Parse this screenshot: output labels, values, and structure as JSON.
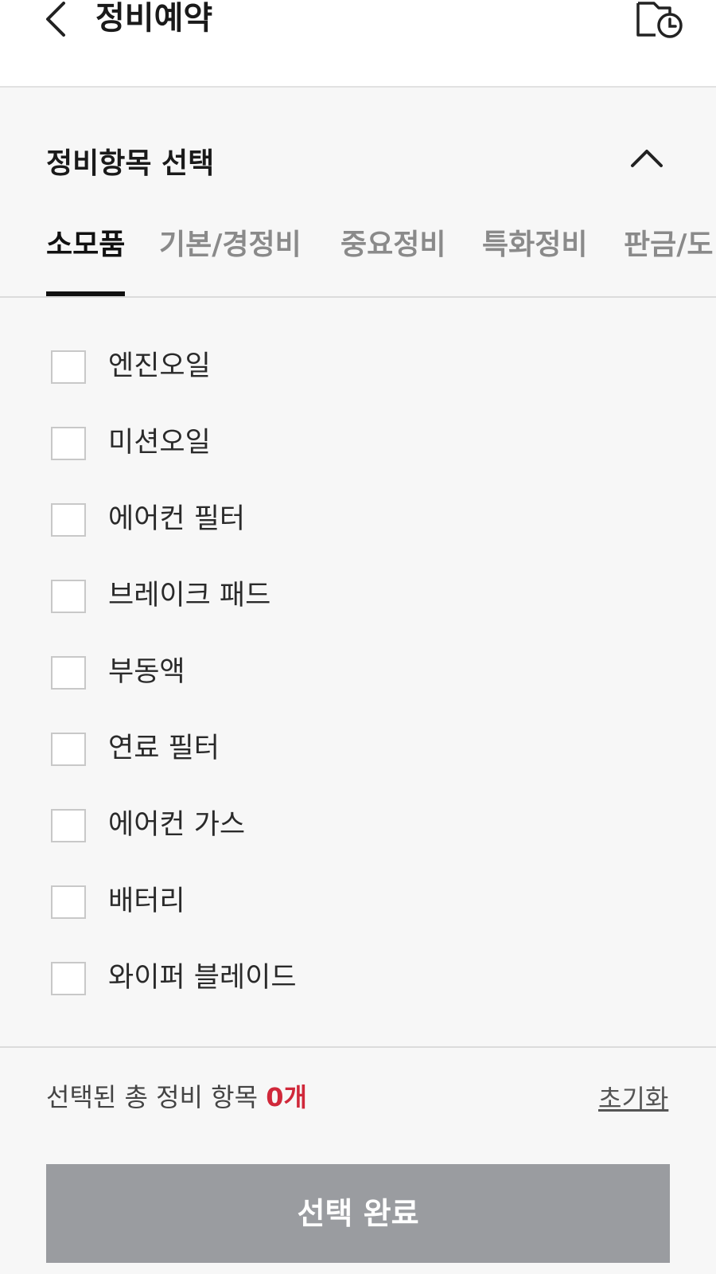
{
  "header": {
    "title": "정비예약",
    "back_icon": "chevron-left-icon",
    "history_icon": "calendar-clock-icon"
  },
  "section": {
    "title": "정비항목 선택",
    "collapse_icon": "chevron-up-icon"
  },
  "tabs": [
    {
      "label": "소모품",
      "active": true
    },
    {
      "label": "기본/경정비",
      "active": false
    },
    {
      "label": "중요정비",
      "active": false
    },
    {
      "label": "특화정비",
      "active": false
    },
    {
      "label": "판금/도",
      "active": false
    }
  ],
  "items": [
    {
      "label": "엔진오일",
      "checked": false
    },
    {
      "label": "미션오일",
      "checked": false
    },
    {
      "label": "에어컨 필터",
      "checked": false
    },
    {
      "label": "브레이크 패드",
      "checked": false
    },
    {
      "label": "부동액",
      "checked": false
    },
    {
      "label": "연료 필터",
      "checked": false
    },
    {
      "label": "에어컨 가스",
      "checked": false
    },
    {
      "label": "배터리",
      "checked": false
    },
    {
      "label": "와이퍼 블레이드",
      "checked": false
    }
  ],
  "footer": {
    "summary_label": "선택된 총 정비 항목",
    "count": "0개",
    "reset_label": "초기화",
    "done_label": "선택 완료"
  },
  "colors": {
    "accent": "#d0283a",
    "button_disabled": "#9a9ca0",
    "background": "#f7f7f7"
  }
}
